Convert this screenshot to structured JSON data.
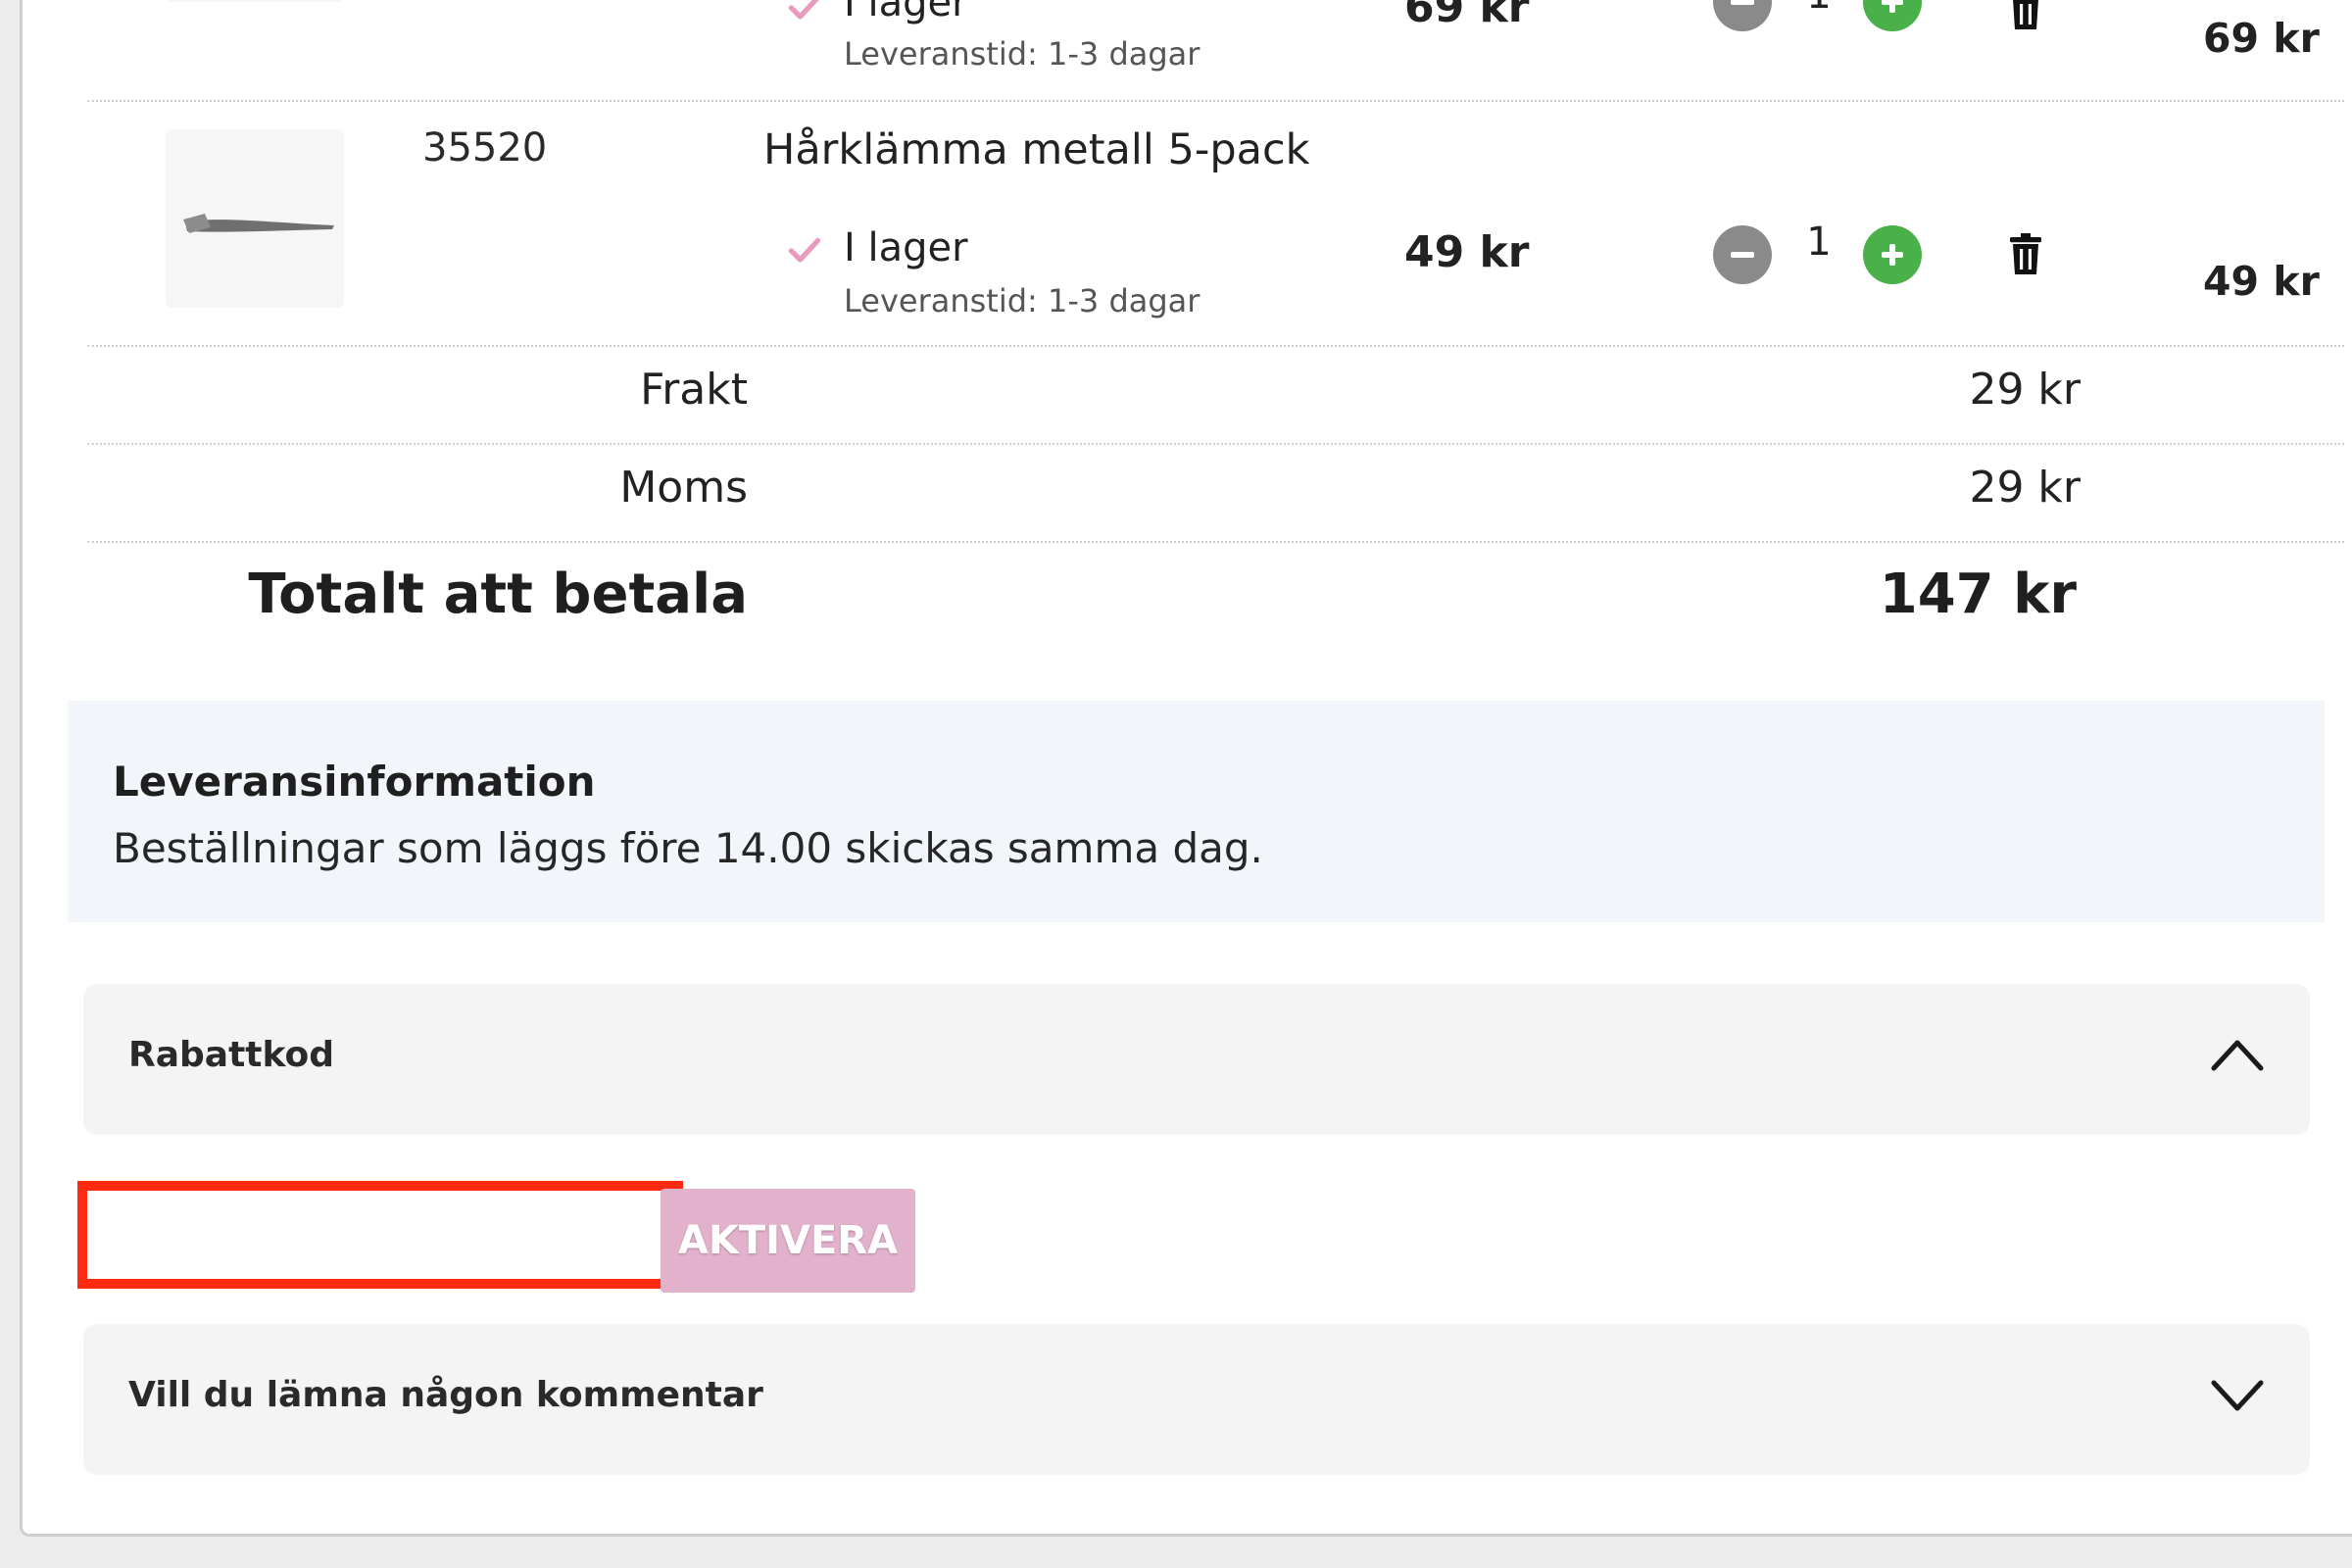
{
  "items": [
    {
      "article_no": "",
      "name": "",
      "stock": "I lager",
      "lead_time": "Leveranstid: 1-3 dagar",
      "unit_price": "69 kr",
      "quantity": "1",
      "row_total": "69 kr"
    },
    {
      "article_no": "35520",
      "name": "Hårklämma metall 5-pack",
      "stock": "I lager",
      "lead_time": "Leveranstid: 1-3 dagar",
      "unit_price": "49 kr",
      "quantity": "1",
      "row_total": "49 kr"
    }
  ],
  "summary": {
    "shipping_label": "Frakt",
    "shipping_value": "29 kr",
    "vat_label": "Moms",
    "vat_value": "29 kr",
    "total_label": "Totalt att betala",
    "total_value": "147 kr"
  },
  "delivery": {
    "title": "Leveransinformation",
    "text": "Beställningar som läggs före 14.00 skickas samma dag."
  },
  "discount": {
    "title": "Rabattkod",
    "input_value": "",
    "button_label": "AKTIVERA",
    "expanded": true
  },
  "comment": {
    "title": "Vill du lämna någon kommentar",
    "expanded": false
  },
  "colors": {
    "check": "#e89ac0",
    "minus": "#8a8a8a",
    "plus": "#4ab04a",
    "activate": "#e2b1cc",
    "highlight": "#ff2a10",
    "delivery_bg": "#f2f6fb"
  },
  "icons": {
    "check": "check-icon",
    "minus": "minus-icon",
    "plus": "plus-icon",
    "trash": "trash-icon",
    "chevron_up": "chevron-up-icon",
    "chevron_down": "chevron-down-icon"
  }
}
